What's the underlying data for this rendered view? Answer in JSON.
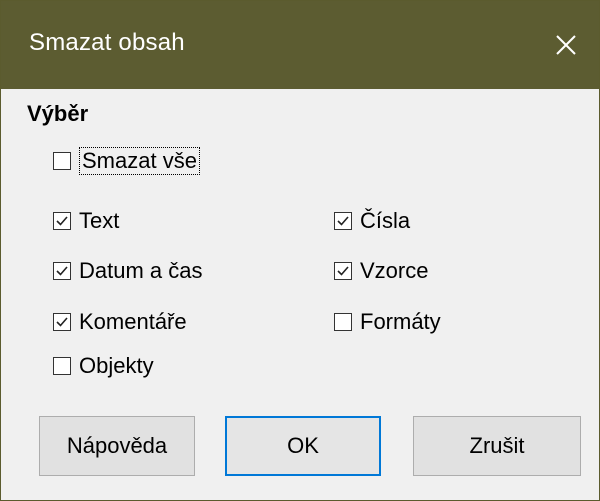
{
  "window": {
    "title": "Smazat obsah"
  },
  "group": {
    "label": "Výběr"
  },
  "checkboxes": {
    "delete_all": {
      "label": "Smazat vše",
      "checked": false
    },
    "text": {
      "label": "Text",
      "checked": true
    },
    "numbers": {
      "label": "Čísla",
      "checked": true
    },
    "datetime": {
      "label": "Datum a čas",
      "checked": true
    },
    "formulas": {
      "label": "Vzorce",
      "checked": true
    },
    "comments": {
      "label": "Komentáře",
      "checked": true
    },
    "formats": {
      "label": "Formáty",
      "checked": false
    },
    "objects": {
      "label": "Objekty",
      "checked": false
    }
  },
  "buttons": {
    "help": "Nápověda",
    "ok": "OK",
    "cancel": "Zrušit"
  },
  "icons": {
    "close": "close-icon",
    "check": "check-icon"
  },
  "colors": {
    "titlebar": "#5c5c31",
    "accent": "#0078d7"
  }
}
